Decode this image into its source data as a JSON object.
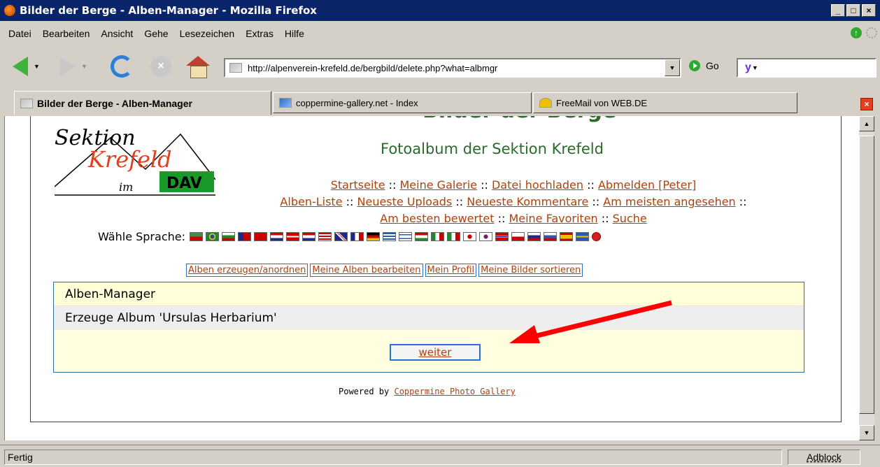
{
  "window": {
    "title": "Bilder der Berge - Alben-Manager - Mozilla Firefox",
    "controls": [
      "_",
      "□",
      "×"
    ]
  },
  "menu": [
    "Datei",
    "Bearbeiten",
    "Ansicht",
    "Gehe",
    "Lesezeichen",
    "Extras",
    "Hilfe"
  ],
  "toolbar": {
    "url": "http://alpenverein-krefeld.de/bergbild/delete.php?what=albmgr",
    "go_label": "Go",
    "search_logo": "y"
  },
  "tabs": [
    {
      "label": "Bilder der Berge - Alben-Manager",
      "active": true
    },
    {
      "label": "coppermine-gallery.net - Index",
      "active": false
    },
    {
      "label": "FreeMail von WEB.DE",
      "active": false
    }
  ],
  "page": {
    "site_title": "Bilder der Berge",
    "subtitle": "Fotoalbum der Sektion Krefeld",
    "logo_text": {
      "line1": "Sektion",
      "line2": "Krefeld",
      "line3": "im",
      "badge": "DAV"
    },
    "nav_row1": [
      "Startseite",
      "Meine Galerie",
      "Datei hochladen",
      "Abmelden [Peter]"
    ],
    "nav_row2": [
      "Alben-Liste",
      "Neueste Uploads",
      "Neueste Kommentare",
      "Am meisten angesehen"
    ],
    "nav_row3": [
      "Am besten bewertet",
      "Meine Favoriten",
      "Suche"
    ],
    "language_label": "Wähle Sprache:",
    "admin_links": [
      "Alben erzeugen/anordnen",
      "Meine Alben bearbeiten",
      "Mein Profil",
      "Meine Bilder sortieren"
    ],
    "table_header": "Alben-Manager",
    "table_row": "Erzeuge Album 'Ursulas Herbarium'",
    "continue_button": "weiter",
    "powered_by": "Powered by",
    "powered_link": "Coppermine Photo Gallery"
  },
  "status": {
    "text": "Fertig",
    "adblock": "Adblock"
  },
  "colors": {
    "title_bg": "#0a246a",
    "link": "#b04010",
    "site_green": "#2a6a2a",
    "table_bg": "#ffffe0",
    "arrow": "#ff0000"
  }
}
